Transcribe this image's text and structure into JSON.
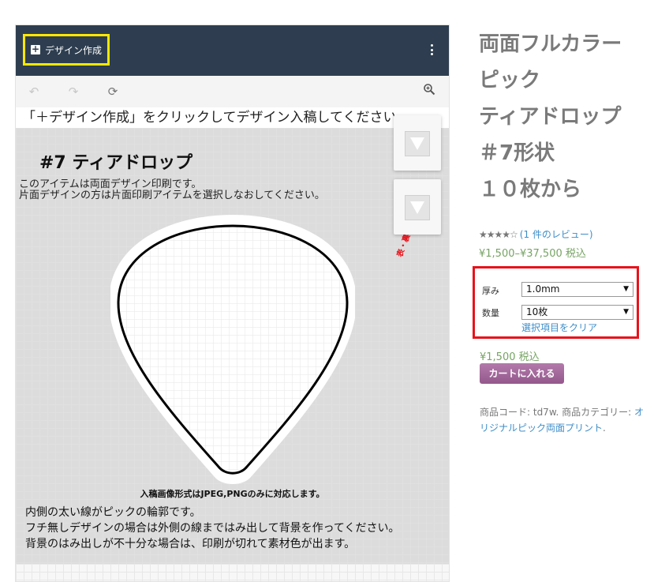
{
  "designer": {
    "create_button_label": "デザイン作成",
    "hint": "「＋デザイン作成」をクリックしてデザイン入稿してください",
    "canvas": {
      "title": "#7 ティアドロップ",
      "desc_line1": "このアイテムは両面デザイン印刷です。",
      "desc_line2": "片面デザインの方は片面印刷アイテムを選択しなおしてください。",
      "flip_label": "表・裏の切り替え⇒",
      "format_note": "入稿画像形式はJPEG,PNGのみに対応します。",
      "note_line1": "内側の太い線がピックの輪郭です。",
      "note_line2": "フチ無しデザインの場合は外側の線まではみ出して背景を作ってください。",
      "note_line3": "背景のはみ出しが不十分な場合は、印刷が切れて素材色が出ます。"
    },
    "icons": {
      "undo": "undo-icon",
      "redo": "redo-icon",
      "refresh": "refresh-icon",
      "zoom": "zoom-in-icon",
      "menu": "vertical-dots-icon"
    }
  },
  "product": {
    "title_lines": [
      "両面フルカラー",
      "ピック",
      "ティアドロップ",
      "＃7形状",
      "１０枚から"
    ],
    "rating_value": 4,
    "rating_max": 5,
    "review_link": "(1 件のレビュー)",
    "price_range": "¥1,500–¥37,500 税込",
    "options": {
      "thickness_label": "厚み",
      "thickness_value": "1.0mm",
      "quantity_label": "数量",
      "quantity_value": "10枚",
      "clear_link": "選択項目をクリア"
    },
    "price": "¥1,500 税込",
    "cart_button": "カートに入れる",
    "meta_prefix": "商品コード: td7w. 商品カテゴリー: ",
    "category_link": "オリジナルピック両面プリント",
    "meta_suffix": "."
  },
  "colors": {
    "topbar": "#2e3e50",
    "highlight_yellow": "#ffe800",
    "highlight_red": "#e8121b",
    "price_green": "#77a464",
    "link_blue": "#3e8ec9",
    "cart_purple": "#a26a9a"
  }
}
